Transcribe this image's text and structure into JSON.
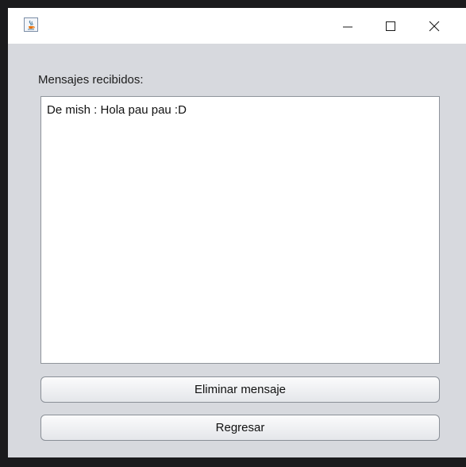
{
  "window": {
    "icon": "java-cup-icon",
    "controls": {
      "minimize": "minimize-icon",
      "maximize": "maximize-icon",
      "close": "close-icon"
    }
  },
  "messages": {
    "label": "Mensajes recibidos:",
    "items": [
      "De mish : Hola pau pau :D"
    ]
  },
  "buttons": {
    "delete": "Eliminar mensaje",
    "back": "Regresar"
  }
}
